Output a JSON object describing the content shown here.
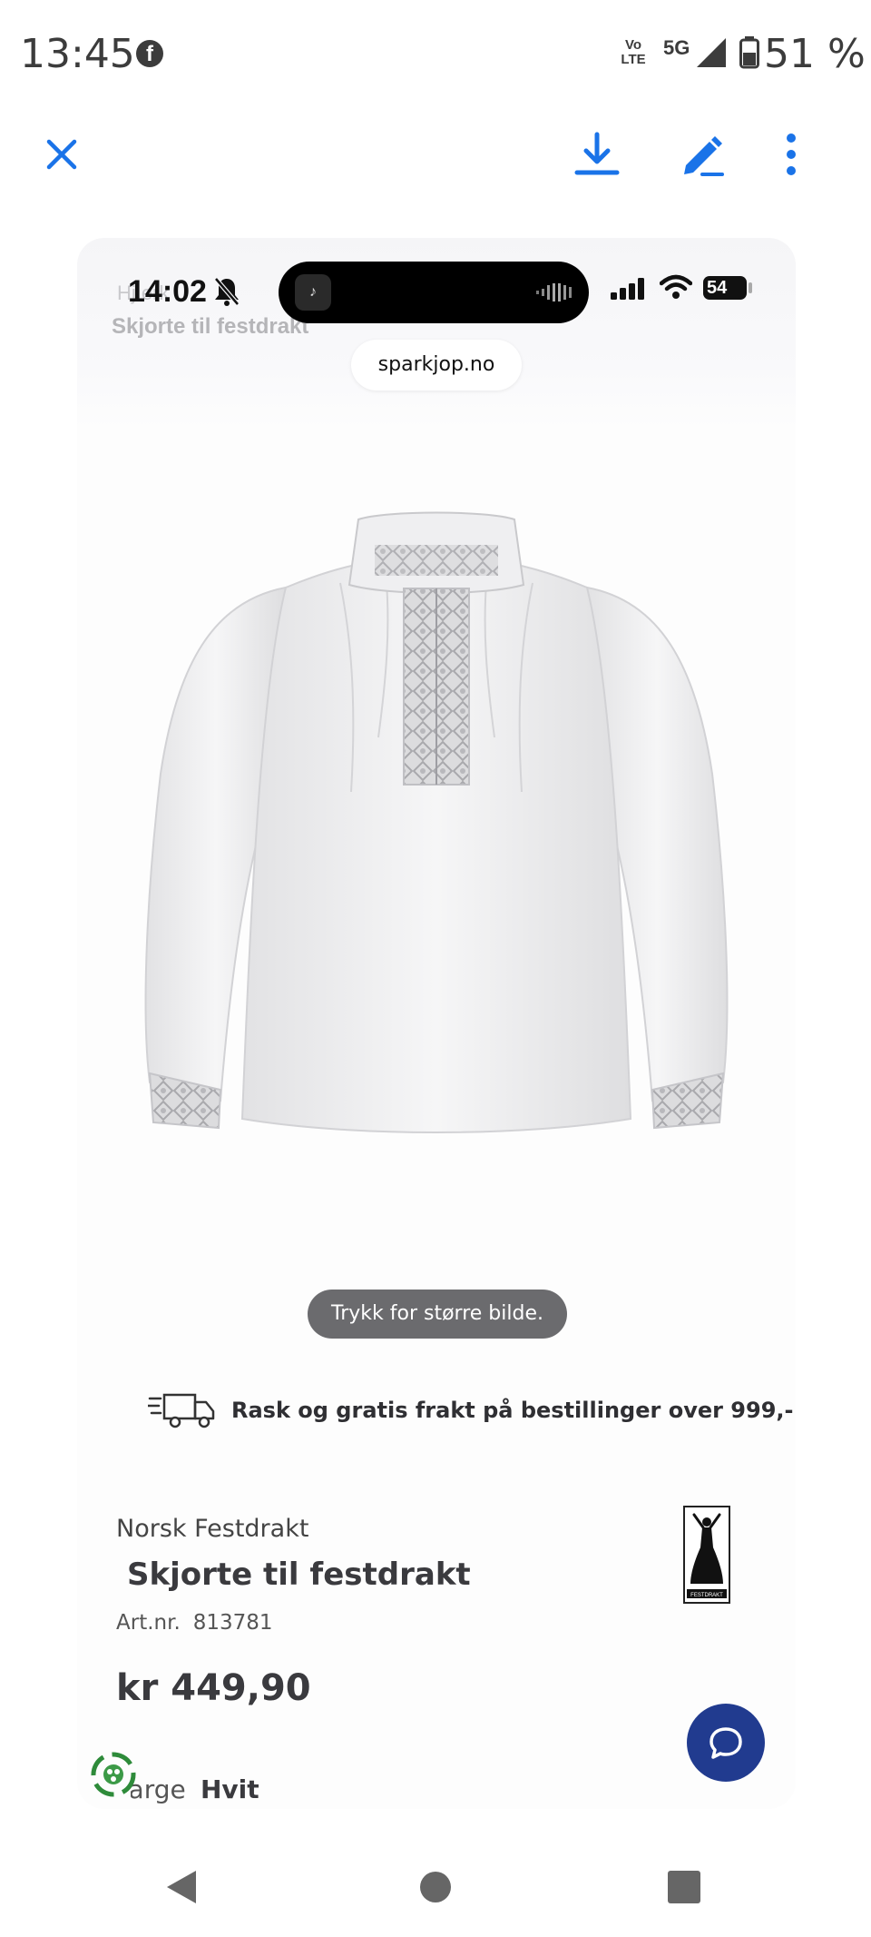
{
  "status_bar": {
    "time": "13:45",
    "facebook_glyph": "f",
    "volte": "Vo LTE",
    "network": "5G",
    "battery_percent": "51 %"
  },
  "toolbar": {
    "icons": [
      "close-icon",
      "download-icon",
      "edit-icon",
      "more-vert-icon"
    ],
    "accent_color": "#1a73e8"
  },
  "screenshot": {
    "inner_status": {
      "time": "14:02",
      "battery": "54"
    },
    "breadcrumb_faded": "Hj erk",
    "subtitle_faded": "Skjorte til festdrakt",
    "url": "sparkjop.no",
    "image_hint": "Trykk for større bilde.",
    "shipping_text": "Rask og gratis frakt på bestillinger over 999,-",
    "product": {
      "brand": "Norsk Festdrakt",
      "title": "Skjorte til festdrakt",
      "art_label": "Art.nr.",
      "art_number": "813781",
      "price": "kr 449,90",
      "color_label": "Farge",
      "color_value": "Hvit",
      "logo_caption": "FESTDRAKT"
    },
    "chat_color": "#213b8f"
  },
  "nav_bar": {
    "icons": [
      "back-icon",
      "home-icon",
      "recents-icon"
    ]
  }
}
